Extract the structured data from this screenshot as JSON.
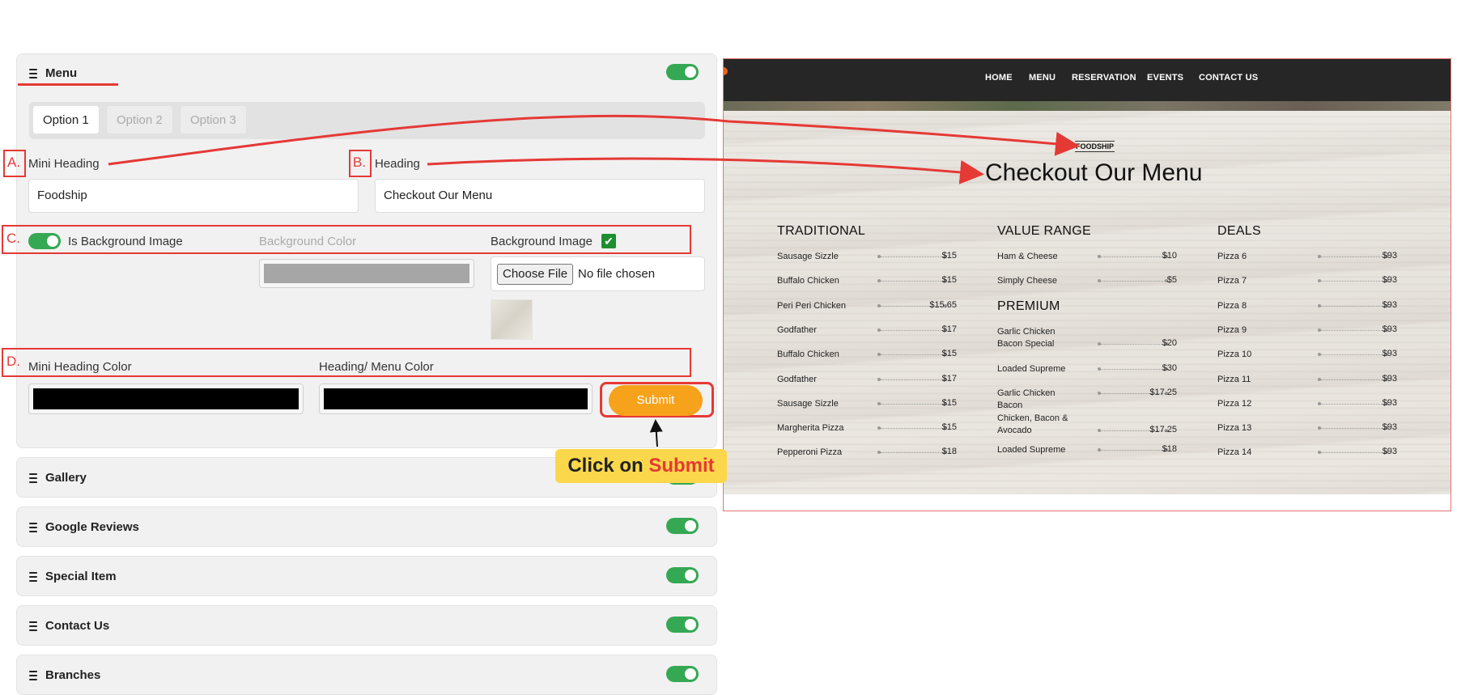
{
  "sections": {
    "menu": {
      "title": "Menu"
    },
    "gallery": {
      "title": "Gallery"
    },
    "google_reviews": {
      "title": "Google Reviews"
    },
    "special_item": {
      "title": "Special Item"
    },
    "contact_us": {
      "title": "Contact Us"
    },
    "branches": {
      "title": "Branches"
    }
  },
  "tabs": [
    "Option 1",
    "Option 2",
    "Option 3"
  ],
  "form": {
    "mini_heading_label": "Mini Heading",
    "mini_heading_value": "Foodship",
    "heading_label": "Heading",
    "heading_value": "Checkout Our Menu",
    "is_bg_image_label": "Is Background Image",
    "bg_color_label": "Background Color",
    "bg_image_label": "Background Image",
    "choose_file_label": "Choose File",
    "no_file_text": "No file chosen",
    "mini_heading_color_label": "Mini Heading Color",
    "heading_menu_color_label": "Heading/ Menu Color",
    "submit_label": "Submit",
    "bg_color_value": "#a6a6a6",
    "mini_heading_color_value": "#000000",
    "heading_menu_color_value": "#000000"
  },
  "annotations": {
    "a": "A.",
    "b": "B.",
    "c": "C.",
    "d": "D.",
    "callout_prefix": "Click on ",
    "callout_highlight": "Submit",
    "accent_color": "#e53935",
    "callout_color": "#fbd74b"
  },
  "preview": {
    "nav": [
      "HOME",
      "MENU",
      "RESERVATION",
      "EVENTS",
      "CONTACT US"
    ],
    "mini_heading": "FOODSHIP",
    "heading": "Checkout Our Menu",
    "columns": {
      "traditional": {
        "title": "TRADITIONAL",
        "items": [
          {
            "name": "Sausage Sizzle",
            "price": "$15"
          },
          {
            "name": "Buffalo Chicken",
            "price": "$15"
          },
          {
            "name": "Peri Peri Chicken",
            "price": "$15.65"
          },
          {
            "name": "Godfather",
            "price": "$17"
          },
          {
            "name": "Buffalo Chicken",
            "price": "$15"
          },
          {
            "name": "Godfather",
            "price": "$17"
          },
          {
            "name": "Sausage Sizzle",
            "price": "$15"
          },
          {
            "name": "Margherita Pizza",
            "price": "$15"
          },
          {
            "name": "Pepperoni Pizza",
            "price": "$18"
          }
        ]
      },
      "value_range": {
        "title": "VALUE RANGE",
        "items": [
          {
            "name": "Ham & Cheese",
            "price": "$10"
          },
          {
            "name": "Simply Cheese",
            "price": "$5"
          }
        ]
      },
      "premium": {
        "title": "PREMIUM",
        "items": [
          {
            "name": "Garlic Chicken Bacon Special",
            "price": "$20"
          },
          {
            "name": "Loaded Supreme",
            "price": "$30"
          },
          {
            "name": "Garlic Chicken Bacon",
            "price": "$17.25"
          },
          {
            "name": "Chicken, Bacon & Avocado",
            "price": "$17.25"
          },
          {
            "name": "Loaded Supreme",
            "price": "$18"
          }
        ]
      },
      "deals": {
        "title": "DEALS",
        "items": [
          {
            "name": "Pizza 6",
            "price": "$93"
          },
          {
            "name": "Pizza 7",
            "price": "$93"
          },
          {
            "name": "Pizza 8",
            "price": "$93"
          },
          {
            "name": "Pizza 9",
            "price": "$93"
          },
          {
            "name": "Pizza 10",
            "price": "$93"
          },
          {
            "name": "Pizza 11",
            "price": "$93"
          },
          {
            "name": "Pizza 12",
            "price": "$93"
          },
          {
            "name": "Pizza 13",
            "price": "$93"
          },
          {
            "name": "Pizza 14",
            "price": "$93"
          }
        ]
      }
    }
  }
}
